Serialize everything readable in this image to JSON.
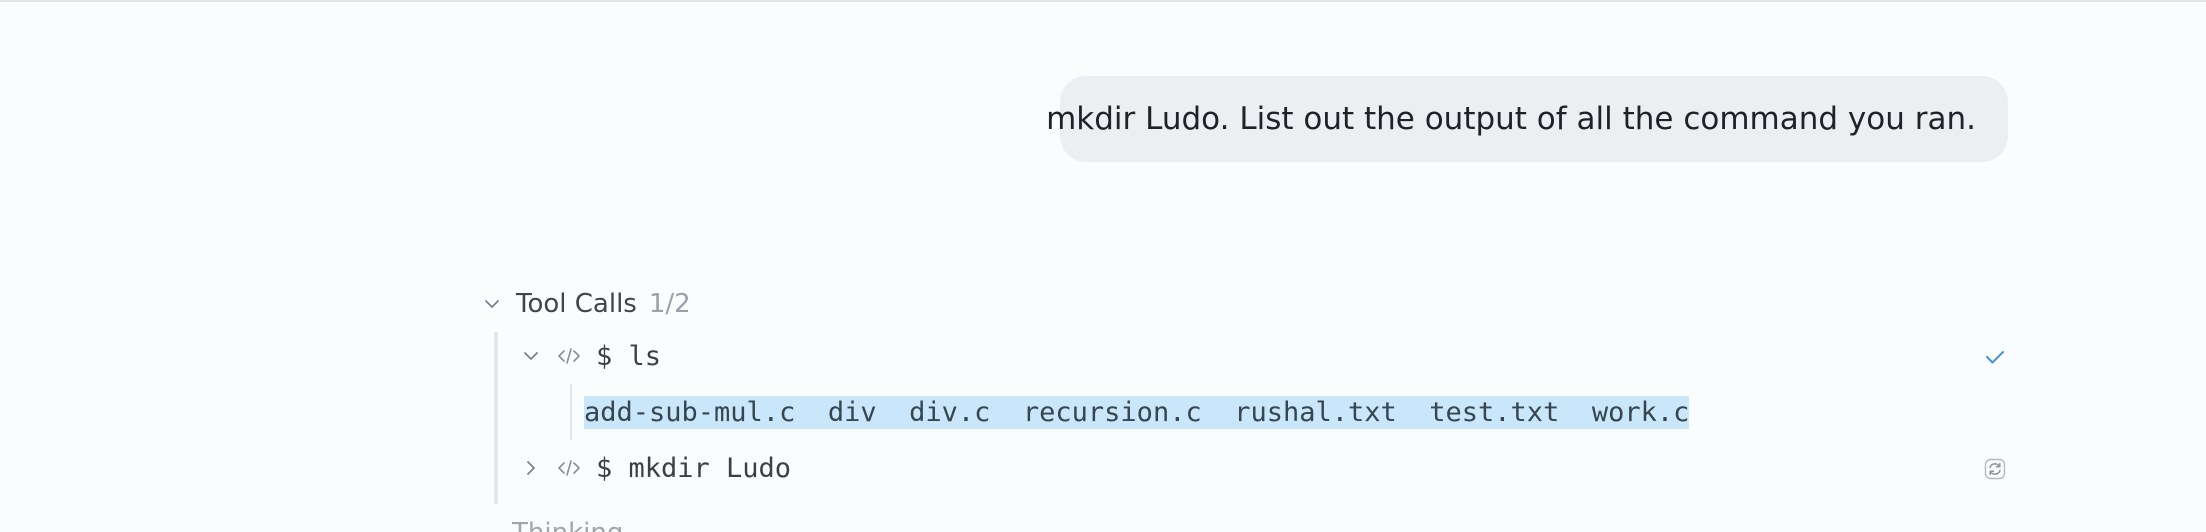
{
  "user_message": {
    "text": "mkdir Ludo. List out the output of all the command you ran."
  },
  "tool_calls": {
    "title": "Tool Calls",
    "count": "1/2",
    "calls": [
      {
        "command": "$ ls",
        "expanded": true,
        "status": "check-icon",
        "output": "add-sub-mul.c  div  div.c  recursion.c  rushal.txt  test.txt  work.c"
      },
      {
        "command": "$ mkdir Ludo",
        "expanded": false,
        "status": "refresh-icon"
      }
    ]
  },
  "thinking": {
    "label": "Thinking"
  },
  "colors": {
    "background": "#f9fdfe",
    "bubble": "#eceff2",
    "selection_highlight": "#cae6fb",
    "status_check": "#4a90d9"
  }
}
